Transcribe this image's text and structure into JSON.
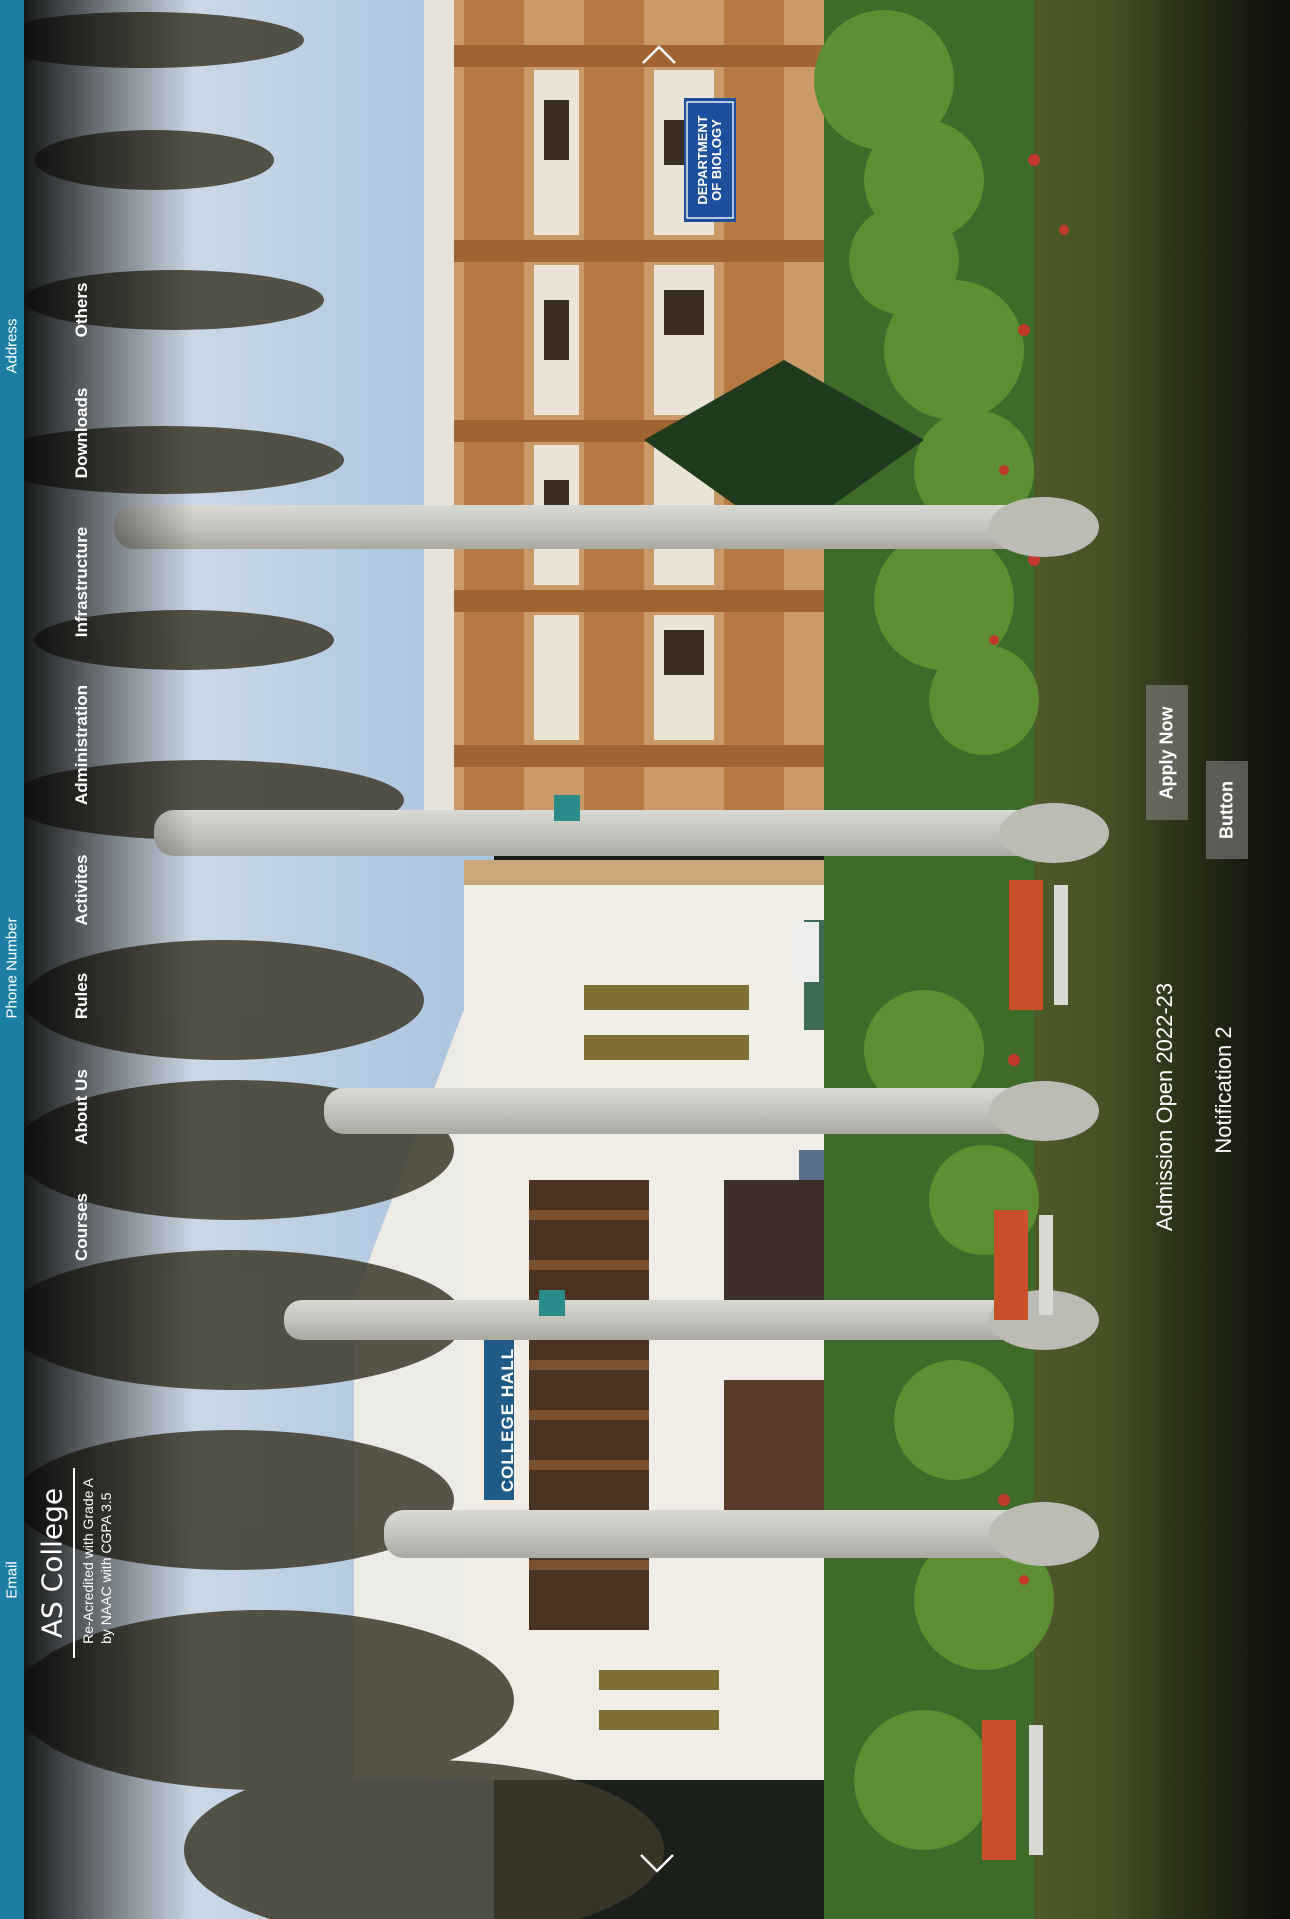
{
  "contact": {
    "address": "Address",
    "phone": "Phone Number",
    "email": "Email"
  },
  "brand": {
    "name": "AS College",
    "tagline": "Re-Acredited with Grade A\nby NAAC with CGPA 3.5"
  },
  "nav": {
    "items": [
      "Others",
      "Downloads",
      "Infrastructure",
      "Administration",
      "Activites",
      "Rules",
      "About Us",
      "Courses"
    ]
  },
  "hero": {
    "headline": "Admission Open 2022-23",
    "subline": "Notification 2",
    "apply_label": "Apply Now",
    "button_label": "Button",
    "signs": {
      "biology": "DEPARTMENT\nOF BIOLOGY",
      "hall": "COLLEGE HALL"
    }
  },
  "carousel": {
    "prev_icon": "chevron-up-icon",
    "next_icon": "chevron-down-icon"
  },
  "colors": {
    "strip": "#1a7fa3",
    "sky": "#b9cde2",
    "grass": "#3d4a22",
    "building_ochre": "#b97a45",
    "sign_blue": "#1d4f9c"
  }
}
